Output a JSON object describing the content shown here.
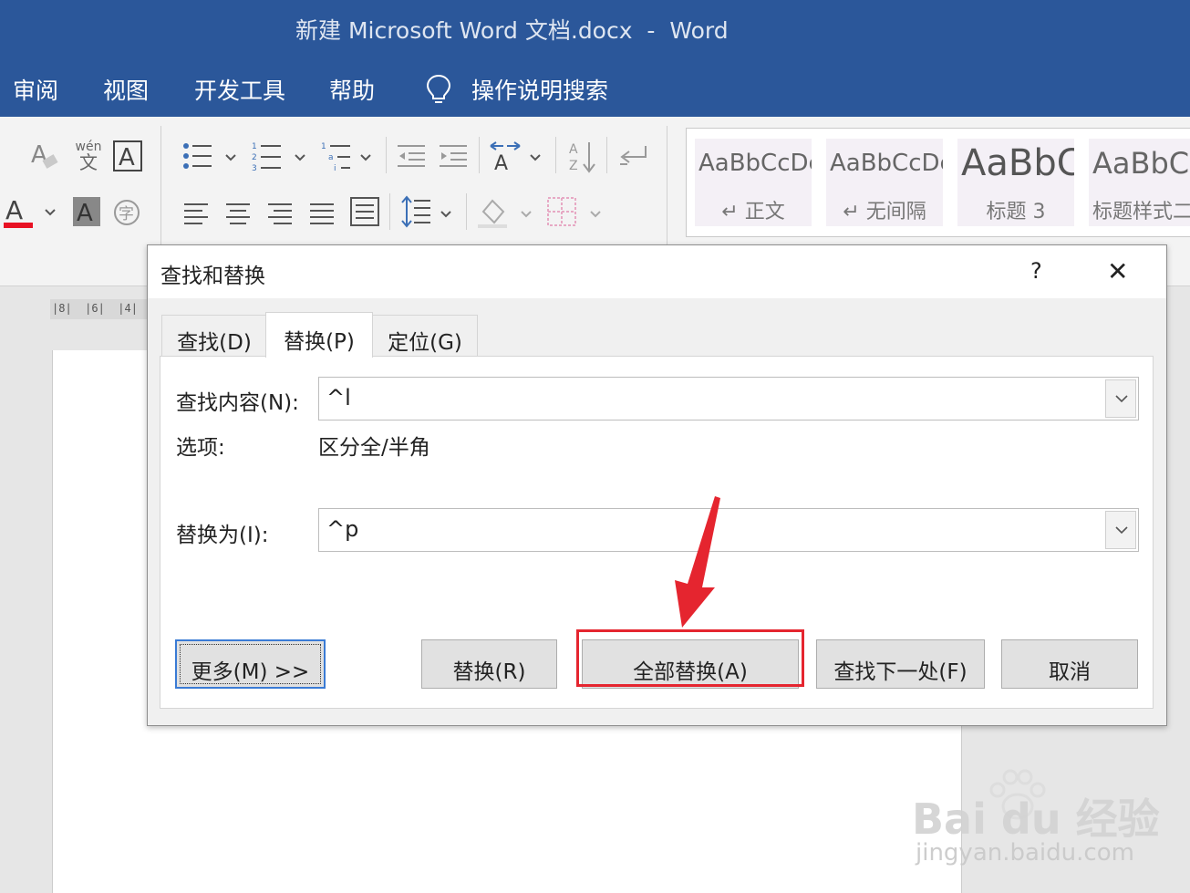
{
  "window": {
    "title": "新建 Microsoft Word 文档.docx  -  Word"
  },
  "menu": {
    "items": [
      "审阅",
      "视图",
      "开发工具",
      "帮助"
    ],
    "tellme": "操作说明搜索"
  },
  "ribbon": {
    "phonetic_top": "wén",
    "phonetic_bottom": "文",
    "styles": [
      {
        "sample": "AaBbCcDc",
        "name": "↵ 正文"
      },
      {
        "sample": "AaBbCcDc",
        "name": "↵ 无间隔"
      },
      {
        "sample": "AaBbC",
        "name": "标题 3"
      },
      {
        "sample": "AaBbCc",
        "name": "标题样式二"
      }
    ],
    "font_color": "#e81123"
  },
  "ruler": {
    "marks": "|8|  |6|  |4|"
  },
  "dialog": {
    "title": "查找和替换",
    "help": "?",
    "close": "✕",
    "tabs": [
      {
        "label": "查找(D)",
        "mnemonic": "D"
      },
      {
        "label": "替换(P)",
        "mnemonic": "P"
      },
      {
        "label": "定位(G)",
        "mnemonic": "G"
      }
    ],
    "find_label": "查找内容(N):",
    "find_value": "^l",
    "options_label": "选项:",
    "options_value": "区分全/半角",
    "replace_label": "替换为(I):",
    "replace_value": "^p",
    "buttons": {
      "more": "更多(M) >>",
      "replace": "替换(R)",
      "replace_all": "全部替换(A)",
      "find_next": "查找下一处(F)",
      "cancel": "取消"
    }
  },
  "watermark": {
    "logo": "Bai du 经验",
    "url": "jingyan.baidu.com"
  },
  "colors": {
    "title_bar": "#2b579a",
    "highlight": "#e5252f",
    "default_button_border": "#3a7bd5"
  }
}
